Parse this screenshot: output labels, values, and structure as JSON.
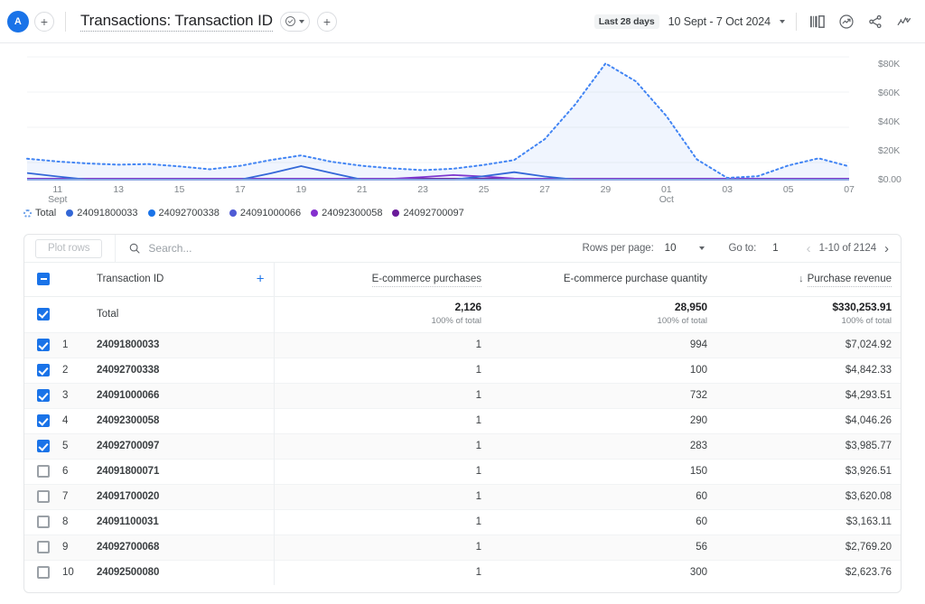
{
  "topbar": {
    "avatar_initial": "A",
    "add_property_label": "+",
    "doc_title": "Transactions: Transaction ID",
    "status_icon": "check-circle-icon",
    "add_tab_label": "+",
    "date_badge": "Last 28 days",
    "date_range": "10 Sept - 7 Oct 2024",
    "icons": [
      "compare-icon",
      "insights-icon",
      "share-icon",
      "trend-icon"
    ]
  },
  "chart_data": {
    "type": "area",
    "title": "",
    "xlabel": "",
    "ylabel": "",
    "ylim": [
      0,
      85000
    ],
    "grid": true,
    "y_ticks": [
      0,
      20000,
      40000,
      60000,
      80000
    ],
    "y_tick_labels": [
      "$0.00",
      "$20K",
      "$40K",
      "$60K",
      "$80K"
    ],
    "x_tick_labels": [
      {
        "day": "11",
        "month": "Sept"
      },
      {
        "day": "13",
        "month": ""
      },
      {
        "day": "15",
        "month": ""
      },
      {
        "day": "17",
        "month": ""
      },
      {
        "day": "19",
        "month": ""
      },
      {
        "day": "21",
        "month": ""
      },
      {
        "day": "23",
        "month": ""
      },
      {
        "day": "25",
        "month": ""
      },
      {
        "day": "27",
        "month": ""
      },
      {
        "day": "29",
        "month": ""
      },
      {
        "day": "01",
        "month": "Oct"
      },
      {
        "day": "03",
        "month": ""
      },
      {
        "day": "05",
        "month": ""
      },
      {
        "day": "07",
        "month": ""
      }
    ],
    "x": [
      10,
      11,
      12,
      13,
      14,
      15,
      16,
      17,
      18,
      19,
      20,
      21,
      22,
      23,
      24,
      25,
      26,
      27,
      28,
      29,
      30,
      31,
      32,
      33,
      34,
      35,
      36,
      37
    ],
    "series": [
      {
        "name": "Total",
        "color": "#4285f4",
        "style": "dotted-area",
        "values": [
          14500,
          12600,
          11200,
          10400,
          10800,
          9200,
          7200,
          9600,
          13600,
          16800,
          12400,
          9600,
          7800,
          6600,
          7600,
          10200,
          13600,
          28000,
          52000,
          80500,
          68000,
          44000,
          14000,
          1200,
          2400,
          9800,
          14800,
          9200
        ]
      },
      {
        "name": "24091800033",
        "color": "#3367d6",
        "style": "line",
        "values": [
          4600,
          2200,
          0,
          0,
          0,
          0,
          0,
          0,
          4400,
          9400,
          4600,
          0,
          0,
          0,
          0,
          2400,
          5200,
          2200,
          0,
          0,
          0,
          0,
          0,
          0,
          0,
          0,
          0,
          0
        ]
      },
      {
        "name": "24092700338",
        "color": "#1a73e8",
        "style": "line",
        "values": [
          0,
          0,
          0,
          0,
          0,
          0,
          0,
          0,
          0,
          0,
          0,
          0,
          0,
          0,
          0,
          0,
          0,
          0,
          0,
          0,
          0,
          0,
          0,
          0,
          0,
          0,
          0,
          0
        ]
      },
      {
        "name": "24091000066",
        "color": "#4f5bd5",
        "style": "line",
        "values": [
          0,
          0,
          0,
          0,
          0,
          0,
          0,
          0,
          0,
          0,
          0,
          0,
          0,
          0,
          0,
          0,
          0,
          0,
          0,
          0,
          0,
          0,
          0,
          0,
          0,
          0,
          0,
          0
        ]
      },
      {
        "name": "24092300058",
        "color": "#8430ce",
        "style": "line",
        "values": [
          600,
          600,
          600,
          600,
          600,
          600,
          600,
          600,
          600,
          600,
          600,
          600,
          600,
          1800,
          3200,
          2200,
          800,
          600,
          600,
          600,
          600,
          600,
          600,
          600,
          600,
          600,
          600,
          600
        ]
      },
      {
        "name": "24092700097",
        "color": "#6a1b9a",
        "style": "line",
        "values": [
          700,
          700,
          700,
          700,
          700,
          700,
          700,
          700,
          700,
          700,
          700,
          700,
          700,
          700,
          700,
          700,
          700,
          700,
          700,
          700,
          700,
          700,
          700,
          700,
          700,
          700,
          700,
          700
        ]
      }
    ],
    "legend_position": "bottom-left"
  },
  "toolbar": {
    "plot_rows_label": "Plot rows",
    "search_placeholder": "Search...",
    "search_value": "",
    "rows_per_page_label": "Rows per page:",
    "rows_per_page_value": "10",
    "goto_label": "Go to:",
    "goto_value": "1",
    "range_label": "1-10 of 2124"
  },
  "table": {
    "dimension_header": "Transaction ID",
    "metric_headers": [
      "E-commerce purchases",
      "E-commerce purchase quantity",
      "Purchase revenue"
    ],
    "sorted_column": "Purchase revenue",
    "sort_direction": "desc",
    "header_checkbox_state": "indeterminate",
    "total_row": {
      "label": "Total",
      "checked": true,
      "metrics": [
        "2,126",
        "28,950",
        "$330,253.91"
      ],
      "subtexts": [
        "100% of total",
        "100% of total",
        "100% of total"
      ]
    },
    "rows": [
      {
        "index": "1",
        "checked": true,
        "id": "24091800033",
        "purchases": "1",
        "quantity": "994",
        "revenue": "$7,024.92"
      },
      {
        "index": "2",
        "checked": true,
        "id": "24092700338",
        "purchases": "1",
        "quantity": "100",
        "revenue": "$4,842.33"
      },
      {
        "index": "3",
        "checked": true,
        "id": "24091000066",
        "purchases": "1",
        "quantity": "732",
        "revenue": "$4,293.51"
      },
      {
        "index": "4",
        "checked": true,
        "id": "24092300058",
        "purchases": "1",
        "quantity": "290",
        "revenue": "$4,046.26"
      },
      {
        "index": "5",
        "checked": true,
        "id": "24092700097",
        "purchases": "1",
        "quantity": "283",
        "revenue": "$3,985.77"
      },
      {
        "index": "6",
        "checked": false,
        "id": "24091800071",
        "purchases": "1",
        "quantity": "150",
        "revenue": "$3,926.51"
      },
      {
        "index": "7",
        "checked": false,
        "id": "24091700020",
        "purchases": "1",
        "quantity": "60",
        "revenue": "$3,620.08"
      },
      {
        "index": "8",
        "checked": false,
        "id": "24091100031",
        "purchases": "1",
        "quantity": "60",
        "revenue": "$3,163.11"
      },
      {
        "index": "9",
        "checked": false,
        "id": "24092700068",
        "purchases": "1",
        "quantity": "56",
        "revenue": "$2,769.20"
      },
      {
        "index": "10",
        "checked": false,
        "id": "24092500080",
        "purchases": "1",
        "quantity": "300",
        "revenue": "$2,623.76"
      }
    ]
  },
  "colors": {
    "accent": "#1a73e8",
    "purple": "#6a1b9a",
    "grid": "#f1f3f4",
    "text": "#3c4043"
  }
}
